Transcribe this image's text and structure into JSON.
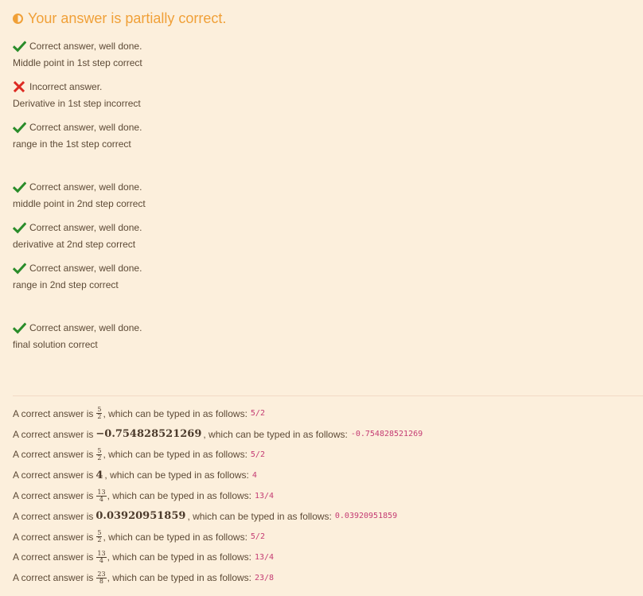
{
  "status": {
    "text": "Your answer is partially correct.",
    "color": "#f0a038",
    "icon": "half-circle-icon"
  },
  "feedback": [
    {
      "correct": true,
      "status_text": "Correct answer, well done.",
      "detail": "Middle point in 1st step correct"
    },
    {
      "correct": false,
      "status_text": "Incorrect answer.",
      "detail": "Derivative in 1st step incorrect"
    },
    {
      "correct": true,
      "status_text": "Correct answer, well done.",
      "detail": "range in the 1st step correct"
    },
    {
      "correct": true,
      "status_text": "Correct answer, well done.",
      "detail": "middle point in 2nd step correct"
    },
    {
      "correct": true,
      "status_text": "Correct answer, well done.",
      "detail": "derivative at 2nd step correct"
    },
    {
      "correct": true,
      "status_text": "Correct answer, well done.",
      "detail": "range in 2nd step correct"
    },
    {
      "correct": true,
      "status_text": "Correct answer, well done.",
      "detail": "final solution correct"
    }
  ],
  "answers": {
    "prefix": "A correct answer is",
    "suffix": ", which can be typed in as follows:",
    "items": [
      {
        "kind": "frac",
        "num": "5",
        "den": "2",
        "typed": "5/2"
      },
      {
        "kind": "num",
        "value": "−0.754828521269",
        "typed": "-0.754828521269"
      },
      {
        "kind": "frac",
        "num": "5",
        "den": "2",
        "typed": "5/2"
      },
      {
        "kind": "num",
        "value": "4",
        "typed": "4"
      },
      {
        "kind": "frac",
        "num": "13",
        "den": "4",
        "typed": "13/4"
      },
      {
        "kind": "num",
        "value": "0.03920951859",
        "typed": "0.03920951859"
      },
      {
        "kind": "frac",
        "num": "5",
        "den": "2",
        "typed": "5/2"
      },
      {
        "kind": "frac",
        "num": "13",
        "den": "4",
        "typed": "13/4"
      },
      {
        "kind": "frac",
        "num": "23",
        "den": "8",
        "typed": "23/8"
      }
    ]
  },
  "colors": {
    "panel_bg": "#fcefdc",
    "correct_mark": "#2a8c2a",
    "incorrect_mark": "#dd2a22",
    "typed_code": "#c43c73"
  }
}
